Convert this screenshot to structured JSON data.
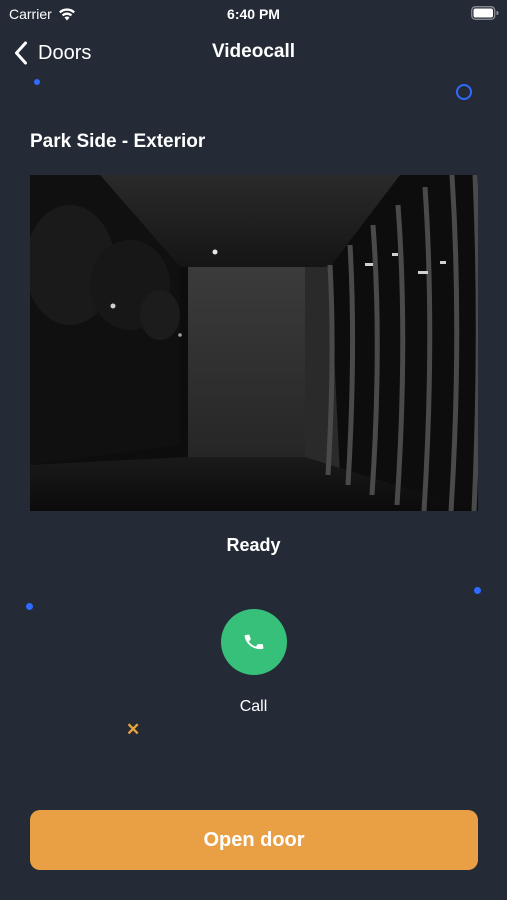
{
  "status_bar": {
    "carrier": "Carrier",
    "time": "6:40 PM",
    "icons": [
      "wifi-icon",
      "battery-icon"
    ]
  },
  "nav": {
    "back_label": "Doors",
    "title": "Videocall",
    "back_icon": "chevron-left-icon"
  },
  "location": {
    "title": "Park Side - Exterior"
  },
  "video": {
    "status": "Ready"
  },
  "call": {
    "label": "Call",
    "icon": "phone-icon"
  },
  "actions": {
    "open_door_label": "Open door"
  },
  "colors": {
    "background": "#242a36",
    "accent_orange": "#e9a045",
    "call_green": "#37c07a",
    "decor_blue": "#2f6bff"
  }
}
